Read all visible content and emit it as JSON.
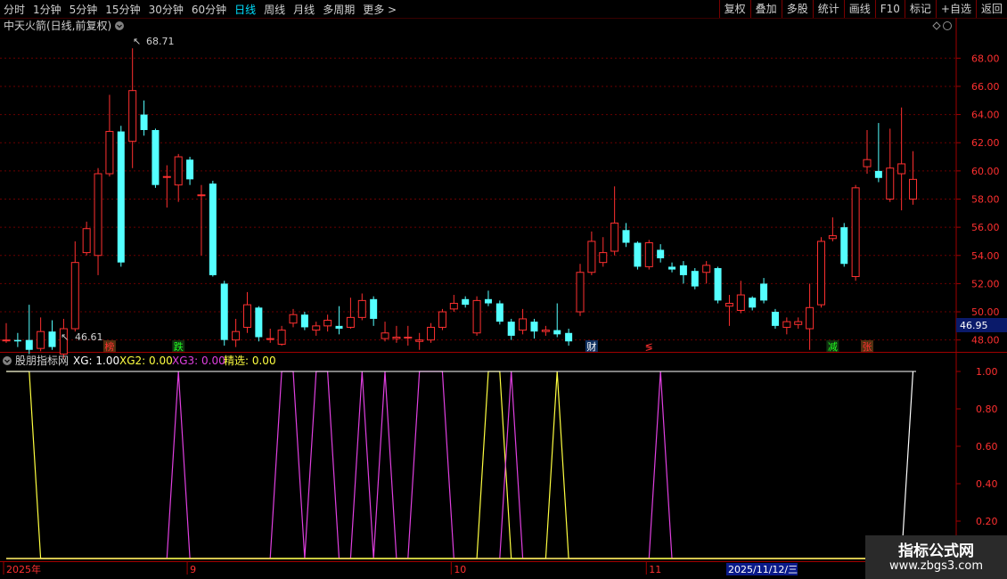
{
  "toolbar": {
    "periods": [
      "分时",
      "1分钟",
      "5分钟",
      "15分钟",
      "30分钟",
      "60分钟",
      "日线",
      "周线",
      "月线",
      "多周期",
      "更多"
    ],
    "active_period": "日线",
    "more_glyph": ">",
    "right_buttons": [
      "复权",
      "叠加",
      "多股",
      "统计",
      "画线",
      "F10",
      "标记",
      "+自选",
      "返回"
    ]
  },
  "main_chart": {
    "title": "中天火箭(日线,前复权)",
    "high_marker": "68.71",
    "low_marker": "46.61",
    "current_price": "46.95",
    "y_ticks": [
      "68.00",
      "66.00",
      "64.00",
      "62.00",
      "60.00",
      "58.00",
      "56.00",
      "54.00",
      "52.00",
      "50.00",
      "48.00"
    ],
    "y_range": [
      47.6,
      69.6
    ],
    "tags": [
      {
        "text": "榜",
        "index": 9,
        "color": "#ff3030",
        "bg": "#503010"
      },
      {
        "text": "跌",
        "index": 15,
        "color": "#20ff20",
        "bg": "#103010"
      },
      {
        "text": "财",
        "index": 51,
        "color": "#ffffff",
        "bg": "#103060"
      },
      {
        "text": "≶",
        "index": 56,
        "color": "#ff3030",
        "bg": ""
      },
      {
        "text": "减",
        "index": 72,
        "color": "#20ff20",
        "bg": "#103010"
      },
      {
        "text": "张",
        "index": 75,
        "color": "#ff3030",
        "bg": "#503010"
      }
    ]
  },
  "chart_data": [
    {
      "type": "candlestick",
      "title": "中天火箭(日线,前复权)",
      "ylim": [
        47.6,
        69.6
      ],
      "candles": [
        {
          "o": 48.0,
          "c": 48.0,
          "h": 49.2,
          "l": 47.8
        },
        {
          "o": 48.0,
          "c": 47.9,
          "h": 48.5,
          "l": 47.5
        },
        {
          "o": 48.0,
          "c": 47.3,
          "h": 50.5,
          "l": 47.0
        },
        {
          "o": 47.4,
          "c": 48.6,
          "h": 49.6,
          "l": 47.2
        },
        {
          "o": 48.6,
          "c": 47.5,
          "h": 49.4,
          "l": 47.3
        },
        {
          "o": 47.0,
          "c": 48.8,
          "h": 49.5,
          "l": 46.7
        },
        {
          "o": 48.8,
          "c": 53.5,
          "h": 55.0,
          "l": 48.6
        },
        {
          "o": 54.2,
          "c": 55.9,
          "h": 56.4,
          "l": 54.0
        },
        {
          "o": 54.0,
          "c": 59.8,
          "h": 60.2,
          "l": 52.6
        },
        {
          "o": 59.8,
          "c": 62.8,
          "h": 65.4,
          "l": 59.6
        },
        {
          "o": 62.8,
          "c": 53.5,
          "h": 63.2,
          "l": 53.2
        },
        {
          "o": 62.1,
          "c": 65.7,
          "h": 68.7,
          "l": 60.2
        },
        {
          "o": 64.0,
          "c": 62.9,
          "h": 65.0,
          "l": 62.5
        },
        {
          "o": 62.9,
          "c": 59.0,
          "h": 63.0,
          "l": 58.8
        },
        {
          "o": 59.6,
          "c": 59.6,
          "h": 60.4,
          "l": 57.4
        },
        {
          "o": 59.0,
          "c": 61.0,
          "h": 61.2,
          "l": 57.8
        },
        {
          "o": 60.8,
          "c": 59.4,
          "h": 61.0,
          "l": 59.0
        },
        {
          "o": 58.3,
          "c": 58.3,
          "h": 59.0,
          "l": 54.0
        },
        {
          "o": 59.1,
          "c": 52.6,
          "h": 59.3,
          "l": 52.5
        },
        {
          "o": 52.0,
          "c": 48.0,
          "h": 52.2,
          "l": 47.6
        },
        {
          "o": 48.0,
          "c": 48.6,
          "h": 49.5,
          "l": 47.5
        },
        {
          "o": 48.9,
          "c": 50.5,
          "h": 51.4,
          "l": 48.5
        },
        {
          "o": 50.3,
          "c": 48.2,
          "h": 50.4,
          "l": 47.9
        },
        {
          "o": 48.1,
          "c": 48.1,
          "h": 48.8,
          "l": 47.8
        },
        {
          "o": 47.7,
          "c": 48.7,
          "h": 49.0,
          "l": 47.6
        },
        {
          "o": 49.2,
          "c": 49.8,
          "h": 50.2,
          "l": 48.9
        },
        {
          "o": 49.8,
          "c": 48.9,
          "h": 50.0,
          "l": 48.7
        },
        {
          "o": 48.7,
          "c": 49.0,
          "h": 49.3,
          "l": 48.3
        },
        {
          "o": 49.0,
          "c": 49.4,
          "h": 49.8,
          "l": 48.6
        },
        {
          "o": 49.0,
          "c": 48.8,
          "h": 50.4,
          "l": 48.4
        },
        {
          "o": 48.9,
          "c": 49.6,
          "h": 51.0,
          "l": 48.8
        },
        {
          "o": 49.6,
          "c": 50.8,
          "h": 51.3,
          "l": 49.4
        },
        {
          "o": 50.9,
          "c": 49.5,
          "h": 51.1,
          "l": 49.0
        },
        {
          "o": 48.1,
          "c": 48.5,
          "h": 49.3,
          "l": 47.9
        },
        {
          "o": 48.1,
          "c": 48.2,
          "h": 49.0,
          "l": 47.8
        },
        {
          "o": 48.2,
          "c": 48.2,
          "h": 49.0,
          "l": 47.6
        },
        {
          "o": 47.9,
          "c": 48.0,
          "h": 48.5,
          "l": 47.3
        },
        {
          "o": 48.0,
          "c": 48.9,
          "h": 49.2,
          "l": 47.8
        },
        {
          "o": 48.9,
          "c": 50.0,
          "h": 50.2,
          "l": 48.7
        },
        {
          "o": 50.2,
          "c": 50.6,
          "h": 51.2,
          "l": 50.0
        },
        {
          "o": 50.9,
          "c": 50.5,
          "h": 51.1,
          "l": 50.3
        },
        {
          "o": 48.5,
          "c": 50.8,
          "h": 51.1,
          "l": 48.3
        },
        {
          "o": 50.9,
          "c": 50.6,
          "h": 51.5,
          "l": 50.4
        },
        {
          "o": 50.6,
          "c": 49.3,
          "h": 50.8,
          "l": 49.1
        },
        {
          "o": 49.3,
          "c": 48.3,
          "h": 49.5,
          "l": 48.0
        },
        {
          "o": 48.7,
          "c": 49.5,
          "h": 50.2,
          "l": 48.4
        },
        {
          "o": 49.3,
          "c": 48.6,
          "h": 49.5,
          "l": 48.1
        },
        {
          "o": 48.6,
          "c": 48.7,
          "h": 49.0,
          "l": 48.3
        },
        {
          "o": 48.7,
          "c": 48.4,
          "h": 50.6,
          "l": 48.2
        },
        {
          "o": 48.5,
          "c": 47.9,
          "h": 48.8,
          "l": 47.6
        },
        {
          "o": 50.0,
          "c": 52.8,
          "h": 53.4,
          "l": 49.7
        },
        {
          "o": 52.8,
          "c": 55.0,
          "h": 55.7,
          "l": 52.6
        },
        {
          "o": 53.5,
          "c": 54.2,
          "h": 55.3,
          "l": 53.2
        },
        {
          "o": 54.3,
          "c": 56.3,
          "h": 58.9,
          "l": 54.0
        },
        {
          "o": 55.8,
          "c": 54.9,
          "h": 56.3,
          "l": 54.6
        },
        {
          "o": 54.9,
          "c": 53.2,
          "h": 55.0,
          "l": 53.0
        },
        {
          "o": 53.2,
          "c": 54.9,
          "h": 55.1,
          "l": 53.0
        },
        {
          "o": 54.4,
          "c": 53.8,
          "h": 54.8,
          "l": 53.5
        },
        {
          "o": 53.2,
          "c": 53.0,
          "h": 53.5,
          "l": 52.8
        },
        {
          "o": 53.3,
          "c": 52.6,
          "h": 53.6,
          "l": 52.0
        },
        {
          "o": 52.9,
          "c": 51.8,
          "h": 53.1,
          "l": 51.6
        },
        {
          "o": 52.8,
          "c": 53.3,
          "h": 53.6,
          "l": 52.0
        },
        {
          "o": 53.1,
          "c": 50.8,
          "h": 53.2,
          "l": 50.6
        },
        {
          "o": 50.4,
          "c": 50.6,
          "h": 51.2,
          "l": 49.0
        },
        {
          "o": 50.1,
          "c": 51.2,
          "h": 52.2,
          "l": 49.9
        },
        {
          "o": 51.0,
          "c": 50.3,
          "h": 51.1,
          "l": 50.1
        },
        {
          "o": 52.0,
          "c": 50.8,
          "h": 52.4,
          "l": 50.6
        },
        {
          "o": 50.0,
          "c": 49.0,
          "h": 50.2,
          "l": 48.8
        },
        {
          "o": 48.9,
          "c": 49.3,
          "h": 49.6,
          "l": 48.4
        },
        {
          "o": 49.1,
          "c": 49.3,
          "h": 49.6,
          "l": 48.8
        },
        {
          "o": 48.8,
          "c": 50.3,
          "h": 52.0,
          "l": 47.3
        },
        {
          "o": 50.5,
          "c": 55.0,
          "h": 55.3,
          "l": 50.3
        },
        {
          "o": 55.2,
          "c": 55.4,
          "h": 56.7,
          "l": 55.0
        },
        {
          "o": 56.0,
          "c": 53.4,
          "h": 56.3,
          "l": 53.2
        },
        {
          "o": 52.5,
          "c": 58.8,
          "h": 59.0,
          "l": 52.2
        },
        {
          "o": 60.3,
          "c": 60.8,
          "h": 62.9,
          "l": 59.8
        },
        {
          "o": 60.0,
          "c": 59.5,
          "h": 63.4,
          "l": 59.2
        },
        {
          "o": 58.0,
          "c": 60.2,
          "h": 63.0,
          "l": 57.8
        },
        {
          "o": 59.8,
          "c": 60.5,
          "h": 64.5,
          "l": 57.2
        },
        {
          "o": 58.0,
          "c": 59.4,
          "h": 61.4,
          "l": 57.6
        }
      ]
    },
    {
      "type": "line",
      "title": "股朋指标网",
      "ylim": [
        0,
        1.08
      ],
      "y_ticks": [
        "1.00",
        "0.80",
        "0.60",
        "0.40",
        "0.20"
      ],
      "legend": {
        "xg": "XG: 1.00",
        "xg2": "XG2: 0.00",
        "xg3": "XG3: 0.00",
        "jingxuan": "精选: 0.00"
      },
      "x_labels": [
        {
          "text": "2025年",
          "index": 0
        },
        {
          "text": "9",
          "index": 16
        },
        {
          "text": "10",
          "index": 39
        },
        {
          "text": "11",
          "index": 56
        }
      ],
      "cursor_date": "2025/11/12/三",
      "series": [
        {
          "name": "XG",
          "color": "#ffffff",
          "values": [
            0,
            0,
            0,
            0,
            0,
            0,
            0,
            0,
            0,
            0,
            0,
            0,
            0,
            0,
            0,
            0,
            0,
            0,
            0,
            0,
            0,
            0,
            0,
            0,
            0,
            0,
            0,
            0,
            0,
            0,
            0,
            0,
            0,
            0,
            0,
            0,
            0,
            0,
            0,
            0,
            0,
            0,
            0,
            0,
            0,
            0,
            0,
            0,
            0,
            0,
            0,
            0,
            0,
            0,
            0,
            0,
            0,
            0,
            0,
            0,
            0,
            0,
            0,
            0,
            0,
            0,
            0,
            0,
            0,
            0,
            0,
            0,
            0,
            0,
            0,
            0,
            0,
            0,
            0,
            1
          ]
        },
        {
          "name": "XG2",
          "color": "#ffff40",
          "values": [
            1,
            1,
            1,
            0,
            0,
            0,
            0,
            0,
            0,
            0,
            0,
            0,
            0,
            0,
            0,
            0,
            0,
            0,
            0,
            0,
            0,
            0,
            0,
            0,
            0,
            0,
            0,
            0,
            0,
            0,
            0,
            0,
            0,
            0,
            0,
            0,
            0,
            0,
            0,
            0,
            0,
            0,
            1,
            1,
            0,
            0,
            0,
            0,
            1,
            0,
            0,
            0,
            0,
            0,
            0,
            0,
            0,
            0,
            0,
            0,
            0,
            0,
            0,
            0,
            0,
            0,
            0,
            0,
            0,
            0,
            0,
            0,
            0,
            0,
            0,
            0,
            0,
            0,
            0,
            0
          ]
        },
        {
          "name": "XG3",
          "color": "#e040e0",
          "values": [
            0,
            0,
            0,
            0,
            0,
            0,
            0,
            0,
            0,
            0,
            0,
            0,
            0,
            0,
            0,
            1,
            0,
            0,
            0,
            0,
            0,
            0,
            0,
            0,
            1,
            1,
            0,
            1,
            1,
            0,
            0,
            1,
            0,
            1,
            0,
            0,
            1,
            1,
            1,
            0,
            0,
            0,
            0,
            0,
            1,
            0,
            0,
            0,
            0,
            0,
            0,
            0,
            0,
            0,
            0,
            0,
            0,
            1,
            0,
            0,
            0,
            0,
            0,
            0,
            0,
            0,
            0,
            0,
            0,
            0,
            0,
            0,
            0,
            0,
            0,
            0,
            0,
            0,
            0,
            0
          ]
        },
        {
          "name": "精选",
          "color": "#ffff40",
          "values": [
            0,
            0,
            0,
            0,
            0,
            0,
            0,
            0,
            0,
            0,
            0,
            0,
            0,
            0,
            0,
            0,
            0,
            0,
            0,
            0,
            0,
            0,
            0,
            0,
            0,
            0,
            0,
            0,
            0,
            0,
            0,
            0,
            0,
            0,
            0,
            0,
            0,
            0,
            0,
            0,
            0,
            0,
            0,
            0,
            0,
            0,
            0,
            0,
            0,
            0,
            0,
            0,
            0,
            0,
            0,
            0,
            0,
            0,
            0,
            0,
            0,
            0,
            0,
            0,
            0,
            0,
            0,
            0,
            0,
            0,
            0,
            0,
            0,
            0,
            0,
            0,
            0,
            0,
            0,
            0
          ]
        }
      ]
    }
  ],
  "indicator_panel": {
    "name": "股朋指标网",
    "xg_label": "XG: 1.00",
    "xg2_label": "XG2: 0.00",
    "xg3_label": "XG3: 0.00",
    "jx_label": "精选: 0.00"
  },
  "colors": {
    "up": "#ff3030",
    "down": "#54ffff",
    "grid": "#800000",
    "axis_text": "#ff3030"
  },
  "watermark": {
    "title": "指标公式网",
    "url": "www.zbgs3.com"
  }
}
